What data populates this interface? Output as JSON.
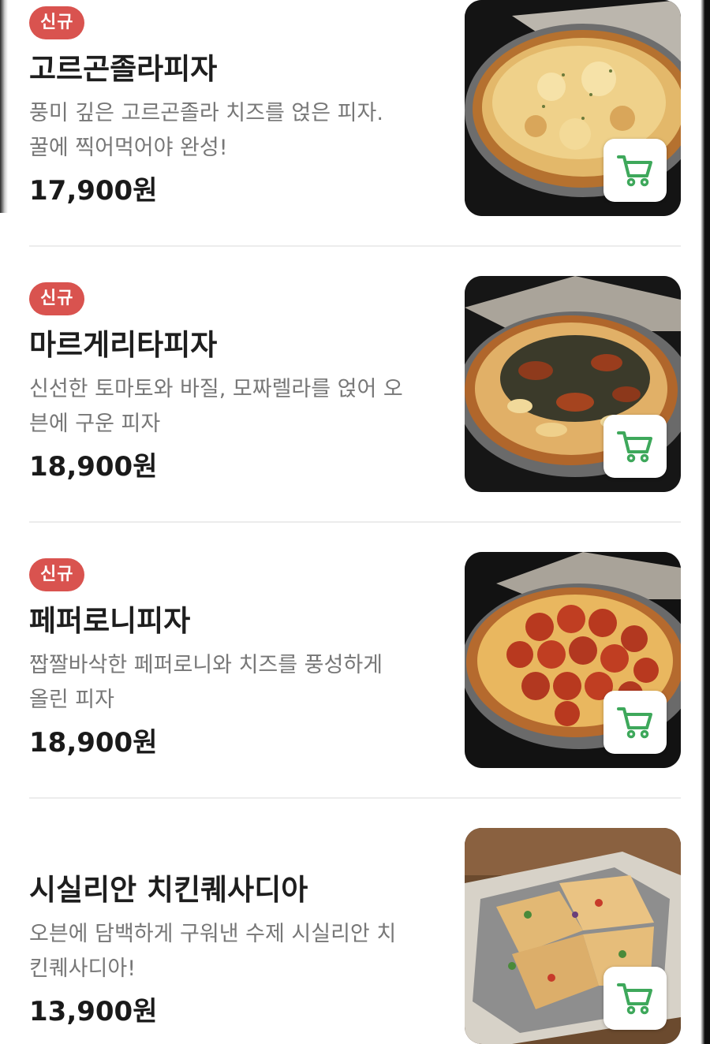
{
  "menu": {
    "items": [
      {
        "badge": "신규",
        "name": "고르곤졸라피자",
        "desc_line1": "풍미 깊은 고르곤졸라 치즈를 얹은 피자.",
        "desc_line2": "꿀에 찍어먹어야 완성!",
        "price": "17,900원",
        "image": "gorgonzola-pizza-photo"
      },
      {
        "badge": "신규",
        "name": "마르게리타피자",
        "desc_line1": "신선한 토마토와 바질, 모짜렐라를 얹어 오",
        "desc_line2": "븐에 구운 피자",
        "price": "18,900원",
        "image": "margherita-pizza-photo"
      },
      {
        "badge": "신규",
        "name": "페퍼로니피자",
        "desc_line1": "짭짤바삭한 페퍼로니와 치즈를 풍성하게",
        "desc_line2": "올린 피자",
        "price": "18,900원",
        "image": "pepperoni-pizza-photo"
      },
      {
        "name": "시실리안 치킨퀘사디아",
        "desc_line1": "오븐에 담백하게 구워낸 수제 시실리안 치",
        "desc_line2": "킨퀘사디아!",
        "price": "13,900원",
        "image": "quesadilla-photo"
      }
    ]
  },
  "colors": {
    "badge": "#d9534f",
    "cart_icon": "#3ea85b",
    "title": "#1e1e1e",
    "desc": "#777777"
  },
  "icons": {
    "cart": "cart-icon"
  }
}
